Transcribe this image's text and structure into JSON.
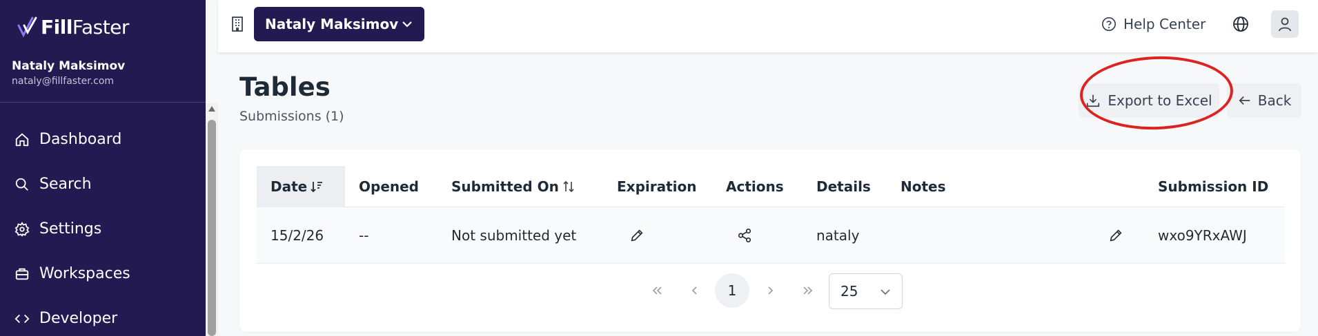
{
  "brand": {
    "logo_bold": "Fill",
    "logo_light": "Faster"
  },
  "user": {
    "name": "Nataly Maksimov",
    "email": "nataly@fillfaster.com"
  },
  "sidebar": {
    "items": [
      {
        "label": "Dashboard",
        "icon": "home-icon"
      },
      {
        "label": "Search",
        "icon": "search-icon"
      },
      {
        "label": "Settings",
        "icon": "gear-icon"
      },
      {
        "label": "Workspaces",
        "icon": "briefcase-icon"
      },
      {
        "label": "Developer",
        "icon": "code-icon"
      }
    ]
  },
  "header": {
    "workspace": "Nataly Maksimov",
    "help_label": "Help Center"
  },
  "page": {
    "title": "Tables",
    "subtitle": "Submissions (1)",
    "export_label": "Export to Excel",
    "back_label": "Back"
  },
  "table": {
    "columns": [
      "Date",
      "Opened",
      "Submitted On",
      "Expiration",
      "Actions",
      "Details",
      "Notes",
      "Submission ID"
    ],
    "rows": [
      {
        "date": "15/2/26",
        "opened": "--",
        "submitted_on": "Not submitted yet",
        "details": "nataly",
        "submission_id": "wxo9YRxAWJ"
      }
    ]
  },
  "pagination": {
    "current_page": "1",
    "page_size": "25"
  },
  "colors": {
    "sidebar_bg": "#231a52",
    "highlight": "#dd2222"
  }
}
